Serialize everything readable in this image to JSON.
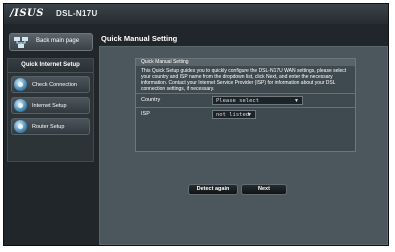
{
  "header": {
    "brand": "/ISUS",
    "model": "DSL-N17U"
  },
  "sidebar": {
    "back_label": "Back main page",
    "section_title": "Quick Internet Setup",
    "items": [
      {
        "label": "Check Connection",
        "icon": "globe-icon"
      },
      {
        "label": "Internet Setup",
        "icon": "globe-icon"
      },
      {
        "label": "Router Setup",
        "icon": "globe-icon"
      }
    ]
  },
  "main": {
    "title": "Quick Manual Setting",
    "box_title": "Quick Manual Setting",
    "intro": "This Quick Setup guides you to quickly configure the DSL-N17U WAN settings, please select your country and ISP name from the dropdown list, click Next, and enter the necessary information. Contact your Internet Service Provider (ISP) for information about your DSL connection settings, if necessary.",
    "country_label": "Country",
    "country_value": "Please select",
    "isp_label": "ISP",
    "isp_value": "not listed",
    "detect_label": "Detect again",
    "next_label": "Next"
  }
}
